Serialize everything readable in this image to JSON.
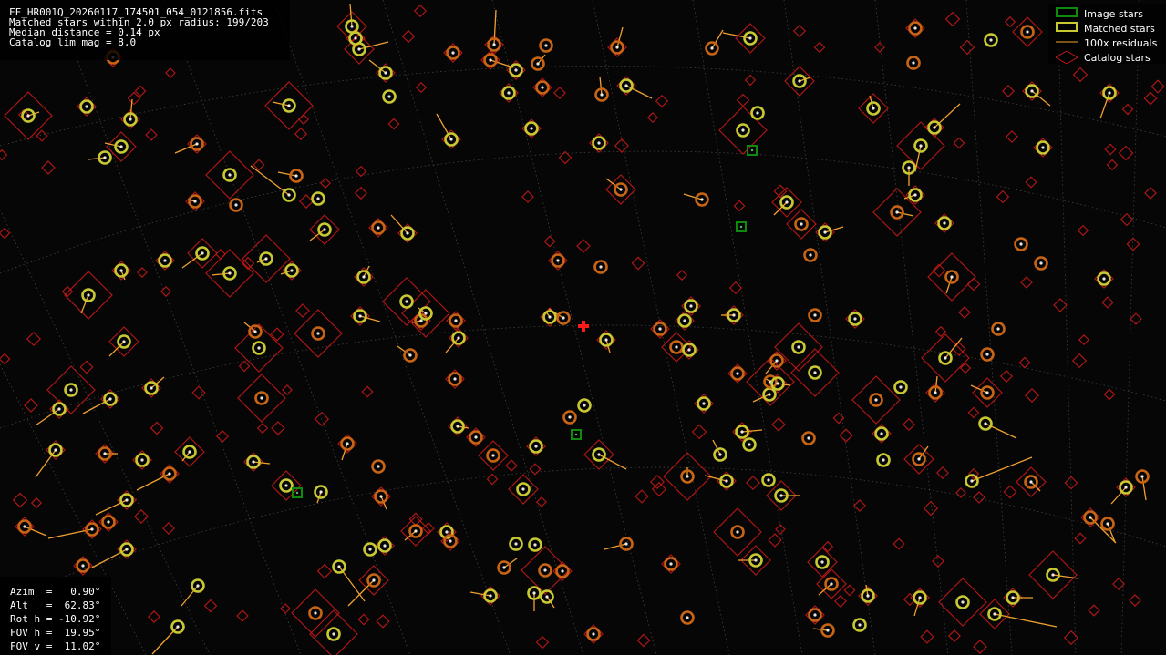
{
  "header": {
    "filename": "FF_HR001Q_20260117_174501_054_0121856.fits",
    "matched_line": "Matched stars within 2.0 px radius: 199/203",
    "median_line": "Median distance = 0.14 px",
    "catalog_line": "Catalog lim mag = 8.0"
  },
  "legend": {
    "image_stars": "Image stars",
    "matched_stars": "Matched stars",
    "residuals": "100x residuals",
    "catalog_stars": "Catalog stars"
  },
  "pointing": {
    "azim": "Azim  =   0.90°",
    "alt": "Alt   =  62.83°",
    "rot": "Rot h = -10.92°",
    "fov_h": "FOV h =  19.95°",
    "fov_v": "FOV v =  11.02°"
  },
  "colors": {
    "background": "#060606",
    "image_star": "#0f8a0f",
    "matched_star": "#c8c832",
    "residual": "#f0a030",
    "catalog_star": "#c01818",
    "grid": "#8c8c8c",
    "center_cross": "#ff1a1a",
    "matched_ring_outer": "#c86414"
  }
}
